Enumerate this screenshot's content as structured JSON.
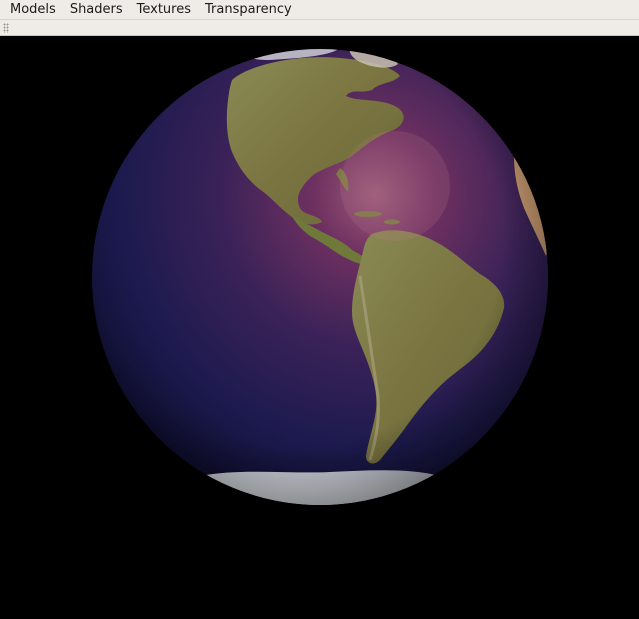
{
  "menubar": {
    "items": [
      {
        "label": "Models"
      },
      {
        "label": "Shaders"
      },
      {
        "label": "Textures"
      },
      {
        "label": "Transparency"
      }
    ]
  },
  "viewport": {
    "scene": "earth-globe",
    "background_color": "#000000",
    "ocean_color": "#1a1a4e",
    "highlight_color": "#7a3a5e",
    "land_color": "#7a7a3e",
    "ice_color": "#e8e8ec"
  }
}
